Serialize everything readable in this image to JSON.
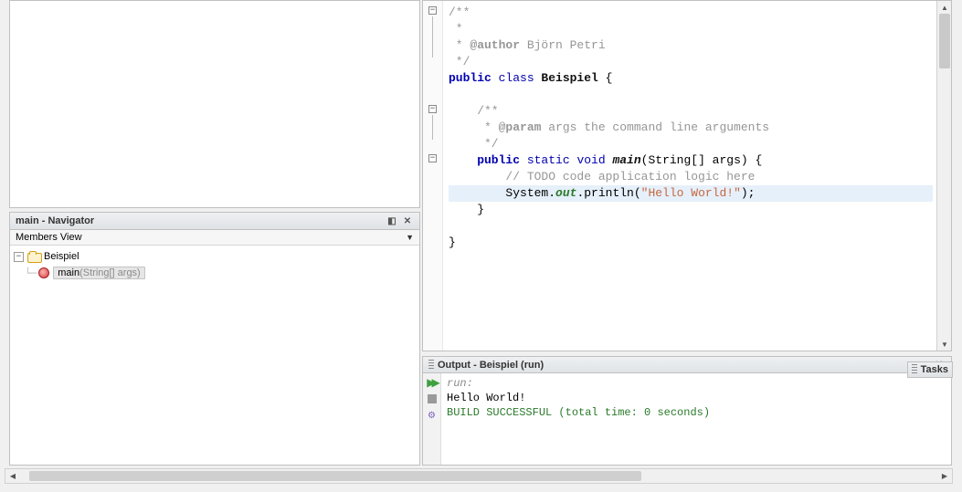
{
  "navigator": {
    "title": "main - Navigator",
    "membersView": "Members View",
    "tree": {
      "class": "Beispiel",
      "method": "main",
      "methodArgs": "(String[] args)"
    }
  },
  "editor": {
    "lines": {
      "l1": "/**",
      "l2": " *",
      "l3a": " * ",
      "l3b": "@author",
      "l3c": " Björn Petri",
      "l4": " */",
      "l5a": "public",
      "l5b": " class ",
      "l5c": "Beispiel",
      "l5d": " {",
      "l7": "    /**",
      "l8a": "     * ",
      "l8b": "@param",
      "l8c": " args the command line arguments",
      "l9": "     */",
      "l10a": "    public",
      "l10b": " static ",
      "l10c": "void ",
      "l10d": "main",
      "l10e": "(String[] args) {",
      "l11": "        // TODO code application logic here",
      "l12a": "        System.",
      "l12b": "out",
      "l12c": ".println(",
      "l12d": "\"Hello World!\"",
      "l12e": ");",
      "l13": "    }",
      "l15": "}"
    }
  },
  "output": {
    "title": "Output - Beispiel (run)",
    "console": {
      "run": "run:",
      "hello": "Hello World!",
      "build": "BUILD SUCCESSFUL (total time: 0 seconds)"
    }
  },
  "tasks": {
    "label": "Tasks"
  }
}
